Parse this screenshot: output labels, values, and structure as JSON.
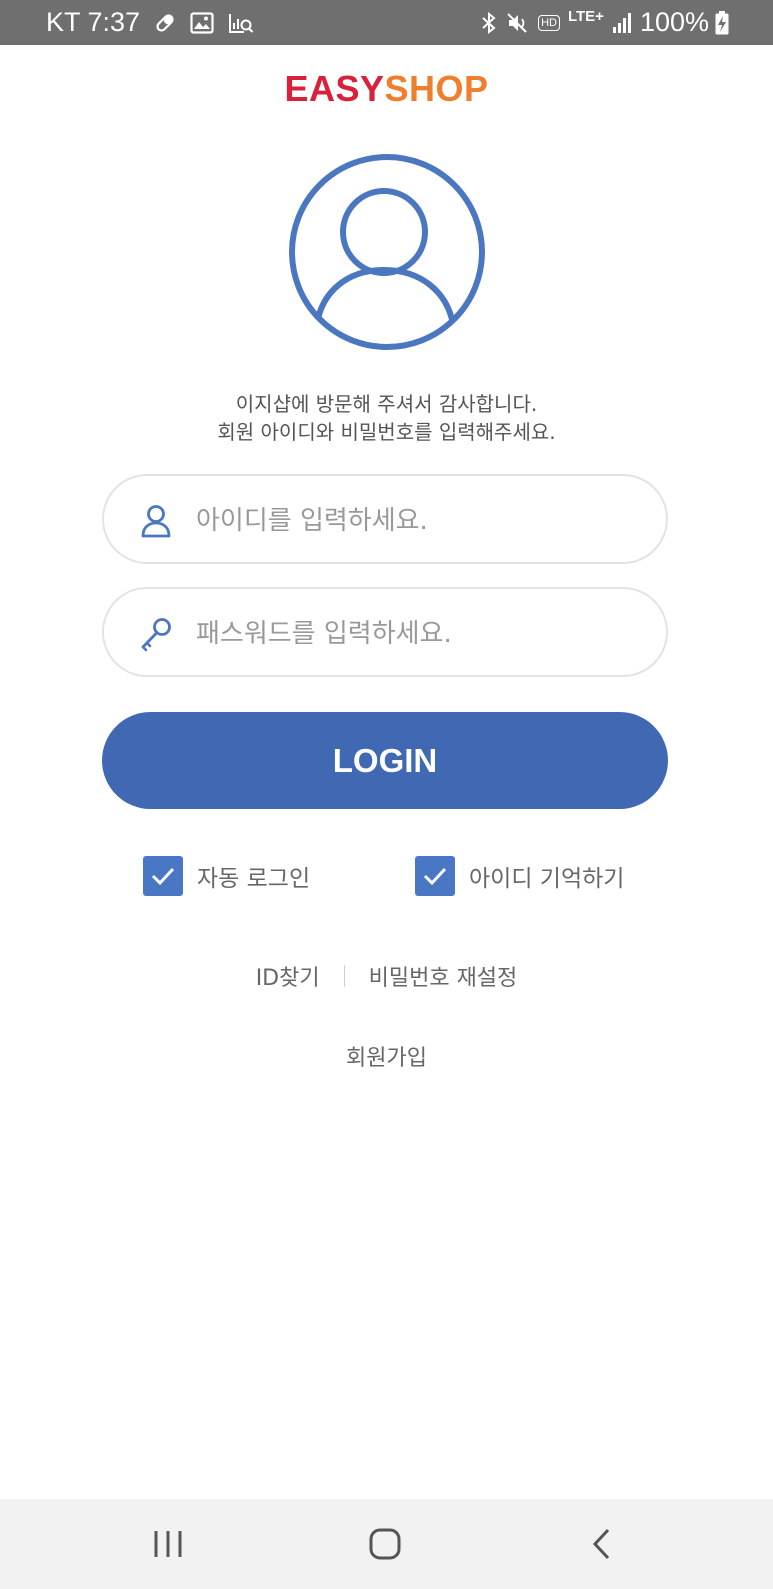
{
  "status_bar": {
    "carrier_time": "KT 7:37",
    "hd_label": "HD",
    "network_label": "LTE+",
    "battery_text": "100%"
  },
  "logo": {
    "part1": "EASY",
    "part2": "SHOP",
    "color1": "#d8213a",
    "color2": "#ef7f2c"
  },
  "welcome": {
    "line1": "이지샵에 방문해 주셔서 감사합니다.",
    "line2": "회원 아이디와 비밀번호를 입력해주세요."
  },
  "form": {
    "id_placeholder": "아이디를 입력하세요.",
    "id_value": "",
    "password_placeholder": "패스워드를 입력하세요.",
    "password_value": "",
    "login_label": "LOGIN",
    "accent_color": "#4068b3"
  },
  "options": {
    "auto_login_label": "자동 로그인",
    "auto_login_checked": true,
    "remember_id_label": "아이디 기억하기",
    "remember_id_checked": true
  },
  "links": {
    "find_id": "ID찾기",
    "reset_password": "비밀번호 재설정",
    "signup": "회원가입"
  },
  "icons": {
    "avatar": "user-avatar-icon",
    "id_field": "person-icon",
    "password_field": "key-icon",
    "checkbox": "check-icon",
    "nav": [
      "recent-apps-icon",
      "home-icon",
      "back-icon"
    ]
  }
}
